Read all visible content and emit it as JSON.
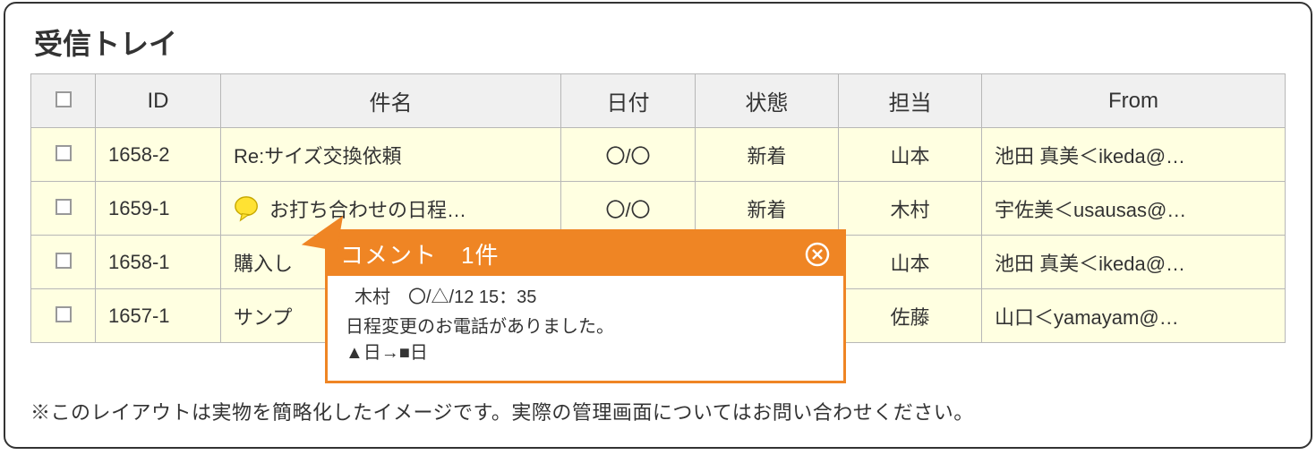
{
  "title": "受信トレイ",
  "columns": {
    "id": "ID",
    "subject": "件名",
    "date": "日付",
    "status": "状態",
    "assignee": "担当",
    "from": "From"
  },
  "rows": [
    {
      "id": "1658-2",
      "subject": "Re:サイズ交換依頼",
      "has_comment": false,
      "date": "〇/〇",
      "status": "新着",
      "assignee": "山本",
      "from": "池田 真美＜ikeda@…"
    },
    {
      "id": "1659-1",
      "subject": "お打ち合わせの日程…",
      "has_comment": true,
      "date": "〇/〇",
      "status": "新着",
      "assignee": "木村",
      "from": "宇佐美＜usausas@…"
    },
    {
      "id": "1658-1",
      "subject": "購入し",
      "has_comment": false,
      "date": "",
      "status": "",
      "assignee": "山本",
      "from": "池田 真美＜ikeda@…"
    },
    {
      "id": "1657-1",
      "subject": "サンプ",
      "has_comment": false,
      "date": "",
      "status": "",
      "assignee": "佐藤",
      "from": "山口＜yamayam@…"
    }
  ],
  "tooltip": {
    "title": "コメント　1件",
    "meta": "木村　〇/△/12 15：35",
    "message": "日程変更のお電話がありました。\n▲日→■日"
  },
  "footnote": "※このレイアウトは実物を簡略化したイメージです。実際の管理画面についてはお問い合わせください。"
}
